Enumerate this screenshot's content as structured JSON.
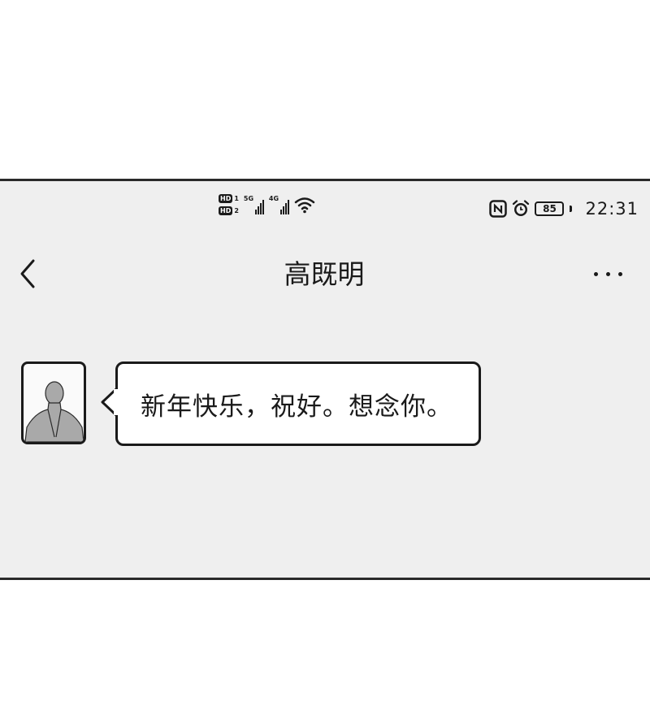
{
  "status_bar": {
    "sim1_badge": "HD",
    "sim1_num": "1",
    "sim2_badge": "HD",
    "sim2_num": "2",
    "net1_label": "5G",
    "net2_label": "4G",
    "battery": "85",
    "time": "22:31"
  },
  "header": {
    "title": "高既明",
    "back_icon": "chevron-left-icon",
    "more_icon": "more-horizontal-icon"
  },
  "messages": [
    {
      "sender": "avatar",
      "text": "新年快乐，祝好。想念你。"
    }
  ],
  "colors": {
    "background": "#efefef",
    "line": "#1a1a1a",
    "bubble": "#ffffff"
  }
}
